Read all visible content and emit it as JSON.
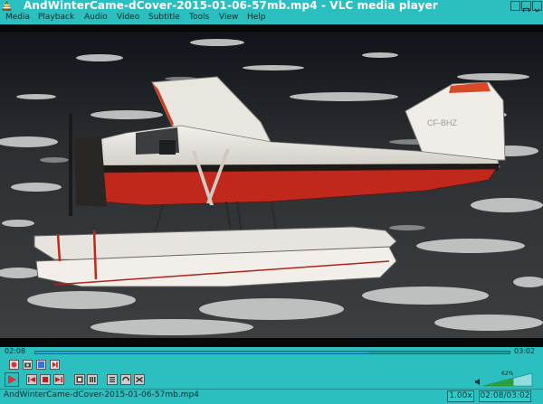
{
  "window": {
    "title": "AndWinterCame-dCover-2015-01-06-57mb.mp4 - VLC media player"
  },
  "menu": {
    "items": [
      "Media",
      "Playback",
      "Audio",
      "Video",
      "Subtitle",
      "Tools",
      "View",
      "Help"
    ]
  },
  "video": {
    "aircraft_registration": "CF-BHZ"
  },
  "seek": {
    "elapsed": "02:08",
    "total": "03:02",
    "progress": 0.703
  },
  "volume": {
    "percent_label": "62%",
    "level": 0.62
  },
  "status": {
    "filename": "AndWinterCame-dCover-2015-01-06-57mb.mp4",
    "speed": "1.00x",
    "time": "02:08/03:02"
  },
  "colors": {
    "chrome": "#2bbfbf",
    "seek_fill": "#23a6e3",
    "record_red": "#e03030"
  }
}
